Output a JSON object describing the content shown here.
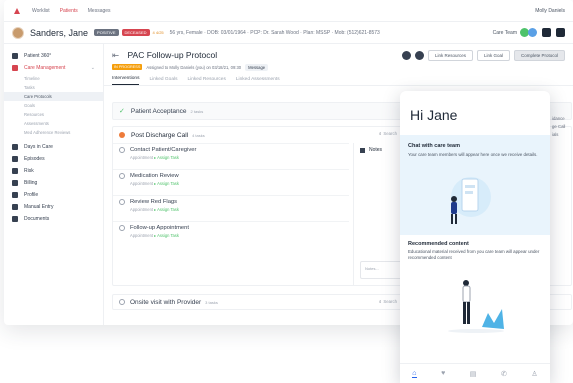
{
  "topnav": {
    "items": [
      "Worklist",
      "Patients",
      "Messages"
    ],
    "user": "Molly Daniels"
  },
  "patient": {
    "name": "Sanders, Jane",
    "badge_gray": "POSITIVE",
    "badge_red": "DECEASED",
    "badge_orange": "4 4/25",
    "meta": "56 yrs, Female · DOB: 03/01/1964 · PCP: Dr. Sarah Wood · Plan: MSSP · Mob: (512)621-8573",
    "care_team": "Care Team"
  },
  "sidebar": {
    "items": [
      {
        "label": "Patient 360°"
      },
      {
        "label": "Care Management"
      }
    ],
    "subitems": [
      "Timeline",
      "Tasks",
      "Care Protocols",
      "Goals",
      "Resources",
      "Assessments",
      "Med Adherence Reviews"
    ],
    "items2": [
      {
        "label": "Days in Care"
      },
      {
        "label": "Episodes"
      },
      {
        "label": "Risk"
      },
      {
        "label": "Billing"
      },
      {
        "label": "Profile"
      },
      {
        "label": "Manual Entry"
      },
      {
        "label": "Documents"
      }
    ]
  },
  "protocol": {
    "title": "PAC Follow-up Protocol",
    "status": "IN PROGRESS",
    "assigned": "Assigned to Molly Daniels (you) on 03/18/21, 09:30",
    "message": "Message",
    "buttons": {
      "link_resources": "Link Resources",
      "link_goal": "Link Goal",
      "complete": "Complete Protocol"
    },
    "tabs": [
      "Interventions",
      "Linked Goals",
      "Linked Resources",
      "Linked Assessments"
    ]
  },
  "acceptance": {
    "title": "Patient Acceptance",
    "count": "2 tasks"
  },
  "discharge": {
    "title": "Post Discharge Call",
    "count": "4 tasks",
    "search": "Search",
    "tasks": [
      {
        "title": "Contact Patient/Caregiver",
        "type": "Appointment",
        "action": "Assign Task"
      },
      {
        "title": "Medication Review",
        "type": "Appointment",
        "action": "Assign Task"
      },
      {
        "title": "Review Red Flags",
        "type": "Appointment",
        "action": "Assign Task"
      },
      {
        "title": "Follow-up Appointment",
        "type": "Appointment",
        "action": "Assign Task"
      }
    ],
    "notes_title": "Notes",
    "notes_placeholder": "Notes..."
  },
  "onsite": {
    "title": "Onsite visit with Provider",
    "count": "3 tasks",
    "search": "Search"
  },
  "peek": {
    "line1": "idance",
    "line2": "ge Call",
    "line3": "ials"
  },
  "phone": {
    "greeting": "Hi Jane",
    "chat_title": "Chat with care team",
    "chat_text": "Your care team members will appear here once we receive details.",
    "rec_title": "Recommended content",
    "rec_text": "Educational material received from you care team will appear under recommended content",
    "nav": [
      "⌂",
      "♥",
      "▤",
      "✆",
      "♙"
    ]
  },
  "colors": {
    "accent_red": "#d64550",
    "accent_green": "#4ec26a",
    "accent_orange": "#ee7b3a",
    "phone_card_bg": "#e9f4fc"
  }
}
